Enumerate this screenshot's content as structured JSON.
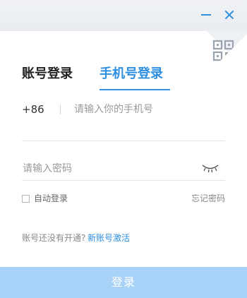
{
  "window": {
    "minimize_icon": "minimize-icon",
    "close_icon": "close-icon",
    "accent_color": "#2e8ee0"
  },
  "qr_login": {
    "icon": "qr-code-icon"
  },
  "tabs": [
    {
      "label": "账号登录",
      "active": false
    },
    {
      "label": "手机号登录",
      "active": true
    }
  ],
  "phone": {
    "country_code": "+86",
    "value": "",
    "placeholder": "请输入你的手机号"
  },
  "password": {
    "value": "",
    "placeholder": "请输入密码",
    "visibility_icon": "eye-closed-icon"
  },
  "options": {
    "auto_login_label": "自动登录",
    "auto_login_checked": false,
    "forgot_password_label": "忘记密码"
  },
  "register": {
    "prompt": "账号还没有开通?",
    "link_label": "新账号激活"
  },
  "login_button": {
    "label": "登录",
    "background_color": "#a9d2f8"
  }
}
